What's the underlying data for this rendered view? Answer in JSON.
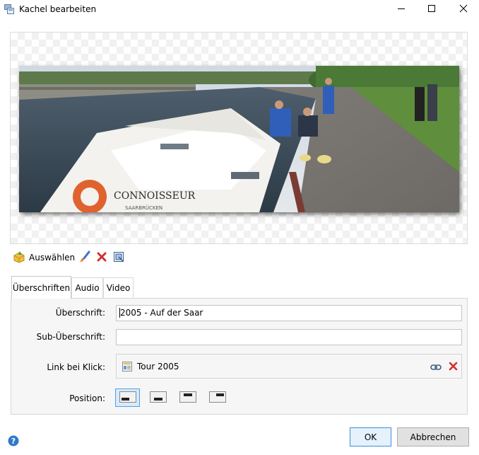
{
  "window": {
    "title": "Kachel bearbeiten",
    "icons": [
      "app-tiles-icon",
      "minimize-icon",
      "maximize-icon",
      "close-icon"
    ]
  },
  "preview": {
    "photo_caption_text": [
      "CONNOISSEUR",
      "SAARBRÜCKEN"
    ]
  },
  "toolbar": {
    "select_label": "Auswählen",
    "icons": [
      "select-image-icon",
      "brush-icon",
      "delete-icon",
      "crop-icon"
    ]
  },
  "tabs": [
    {
      "label": "Überschriften",
      "active": true
    },
    {
      "label": "Audio",
      "active": false
    },
    {
      "label": "Video",
      "active": false
    }
  ],
  "form": {
    "title_label": "Überschrift:",
    "title_value": "2005 - Auf der Saar",
    "subtitle_label": "Sub-Überschrift:",
    "subtitle_value": "",
    "link_label": "Link bei Klick:",
    "link_value": "Tour 2005",
    "position_label": "Position:",
    "position_options": [
      "bottom-left",
      "bottom-center",
      "top-center",
      "top-right"
    ],
    "position_selected": 0
  },
  "footer": {
    "ok_label": "OK",
    "cancel_label": "Abbrechen"
  },
  "colors": {
    "accent": "#3c8fd9",
    "selected_bg": "#d7eafb",
    "delete_red": "#d32f2f"
  }
}
